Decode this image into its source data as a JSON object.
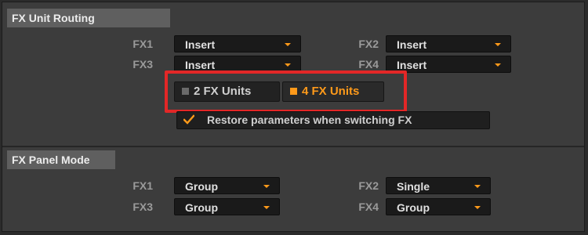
{
  "colors": {
    "accent": "#ff9a1a",
    "highlight": "#e32727"
  },
  "routing": {
    "title": "FX Unit Routing",
    "rows": [
      {
        "label": "FX1",
        "value": "Insert"
      },
      {
        "label": "FX2",
        "value": "Insert"
      },
      {
        "label": "FX3",
        "value": "Insert"
      },
      {
        "label": "FX4",
        "value": "Insert"
      }
    ],
    "units": [
      {
        "label": "2 FX Units",
        "selected": false
      },
      {
        "label": "4 FX Units",
        "selected": true
      }
    ],
    "restore": {
      "label": "Restore parameters when switching FX",
      "checked": true,
      "icon": "checkmark-icon"
    }
  },
  "panel_mode": {
    "title": "FX Panel Mode",
    "rows": [
      {
        "label": "FX1",
        "value": "Group"
      },
      {
        "label": "FX2",
        "value": "Single"
      },
      {
        "label": "FX3",
        "value": "Group"
      },
      {
        "label": "FX4",
        "value": "Group"
      }
    ]
  }
}
